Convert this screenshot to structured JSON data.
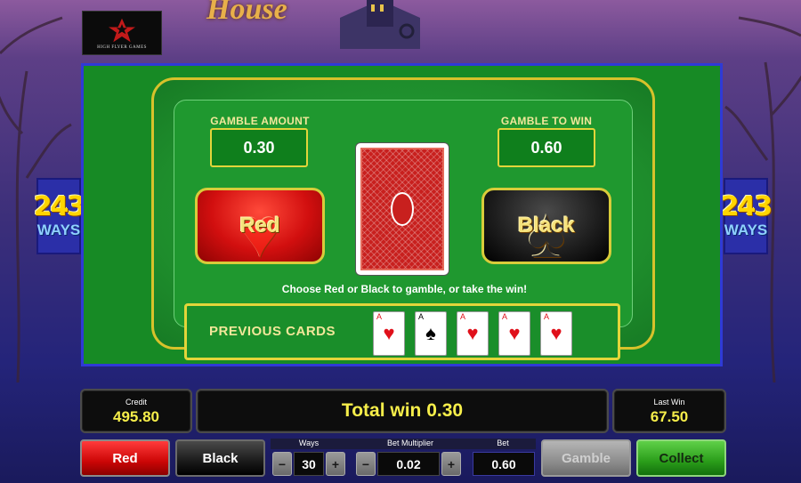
{
  "game": {
    "logo_text": "HIGH FLYER GAMES",
    "title_fragment": "House",
    "ways_number": "243",
    "ways_word": "WAYS"
  },
  "gamble": {
    "amount_label": "GAMBLE AMOUNT",
    "amount_value": "0.30",
    "to_win_label": "GAMBLE TO WIN",
    "to_win_value": "0.60",
    "red_button": "Red",
    "black_button": "Black",
    "instruction": "Choose Red or Black to gamble, or take the win!",
    "previous_cards_label": "PREVIOUS CARDS",
    "previous_cards": [
      {
        "rank": "A",
        "suit": "♥",
        "color": "red"
      },
      {
        "rank": "A",
        "suit": "♠",
        "color": "black"
      },
      {
        "rank": "A",
        "suit": "♥",
        "color": "red"
      },
      {
        "rank": "A",
        "suit": "♥",
        "color": "red"
      },
      {
        "rank": "A",
        "suit": "♥",
        "color": "red"
      }
    ]
  },
  "bottom": {
    "credit_label": "Credit",
    "credit_value": "495.80",
    "total_win": "Total win 0.30",
    "last_win_label": "Last Win",
    "last_win_value": "67.50",
    "red_button": "Red",
    "black_button": "Black",
    "ways_label": "Ways",
    "ways_value": "30",
    "bet_multiplier_label": "Bet Multiplier",
    "bet_multiplier_value": "0.02",
    "bet_label": "Bet",
    "bet_value": "0.60",
    "gamble_button": "Gamble",
    "collect_button": "Collect",
    "minus": "−",
    "plus": "+"
  },
  "colors": {
    "felt_green": "#1f982f",
    "gold_border": "#e2d53a",
    "panel_border": "#2f3ad6",
    "value_yellow": "#f6ee4a"
  }
}
